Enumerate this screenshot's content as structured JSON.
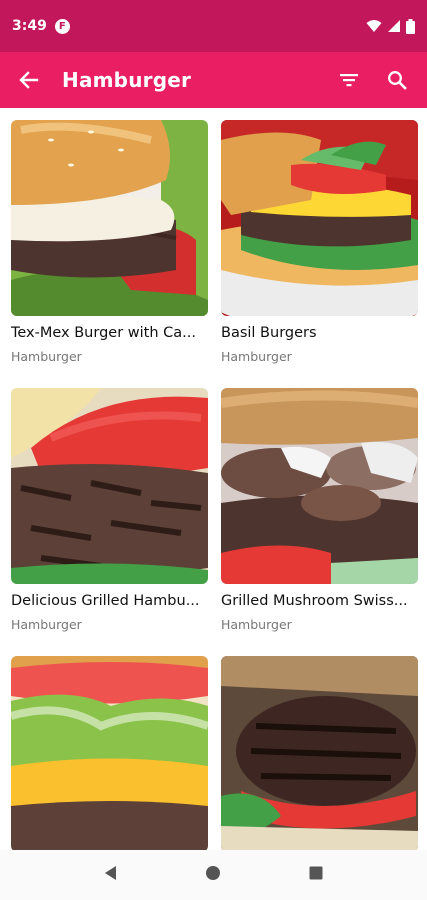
{
  "status": {
    "time": "3:49",
    "app_badge": "F"
  },
  "app_bar": {
    "title": "Hamburger"
  },
  "icons": {
    "back": "arrow-back-icon",
    "filter": "filter-icon",
    "search": "search-icon"
  },
  "colors": {
    "status_bar": "#c2185b",
    "app_bar": "#e91e63"
  },
  "recipes": [
    {
      "title": "Tex-Mex Burger with Ca...",
      "category": "Hamburger"
    },
    {
      "title": "Basil Burgers",
      "category": "Hamburger"
    },
    {
      "title": "Delicious Grilled Hambu...",
      "category": "Hamburger"
    },
    {
      "title": "Grilled Mushroom Swiss...",
      "category": "Hamburger"
    },
    {
      "title": "",
      "category": ""
    },
    {
      "title": "",
      "category": ""
    }
  ]
}
